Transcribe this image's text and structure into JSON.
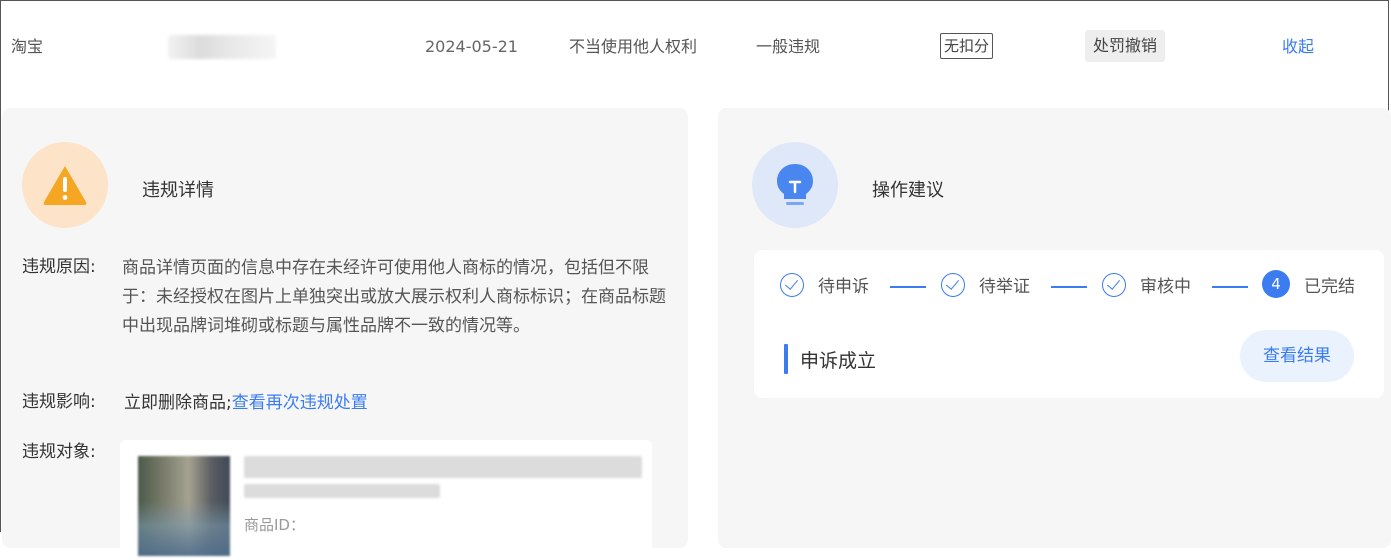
{
  "record": {
    "platform": "淘宝",
    "date": "2024-05-21",
    "violation_type": "不当使用他人权利",
    "level": "一般违规",
    "points": "无扣分",
    "status": "处罚撤销",
    "collapse_label": "收起"
  },
  "details": {
    "title": "违规详情",
    "reason_label": "违规原因:",
    "reason_text": "商品详情页面的信息中存在未经许可使用他人商标的情况，包括但不限于：未经授权在图片上单独突出或放大展示权利人商标标识；在商品标题中出现品牌词堆砌或标题与属性品牌不一致的情况等。",
    "impact_label": "违规影响:",
    "impact_text": "立即删除商品;",
    "impact_link": "查看再次违规处置",
    "object_label": "违规对象:",
    "object_id_prefix": "商品ID："
  },
  "advice": {
    "title": "操作建议",
    "steps": [
      {
        "label": "待申诉",
        "state": "done"
      },
      {
        "label": "待举证",
        "state": "done"
      },
      {
        "label": "审核中",
        "state": "done"
      },
      {
        "label": "已完结",
        "state": "current",
        "number": "4"
      }
    ],
    "result": "申诉成立",
    "view_button": "查看结果"
  },
  "colors": {
    "accent": "#3b7cf0",
    "warning": "#f5a623",
    "panel_bg": "#f6f6f6"
  },
  "icons": {
    "warning": "warning-triangle-icon",
    "bulb": "lightbulb-icon"
  }
}
